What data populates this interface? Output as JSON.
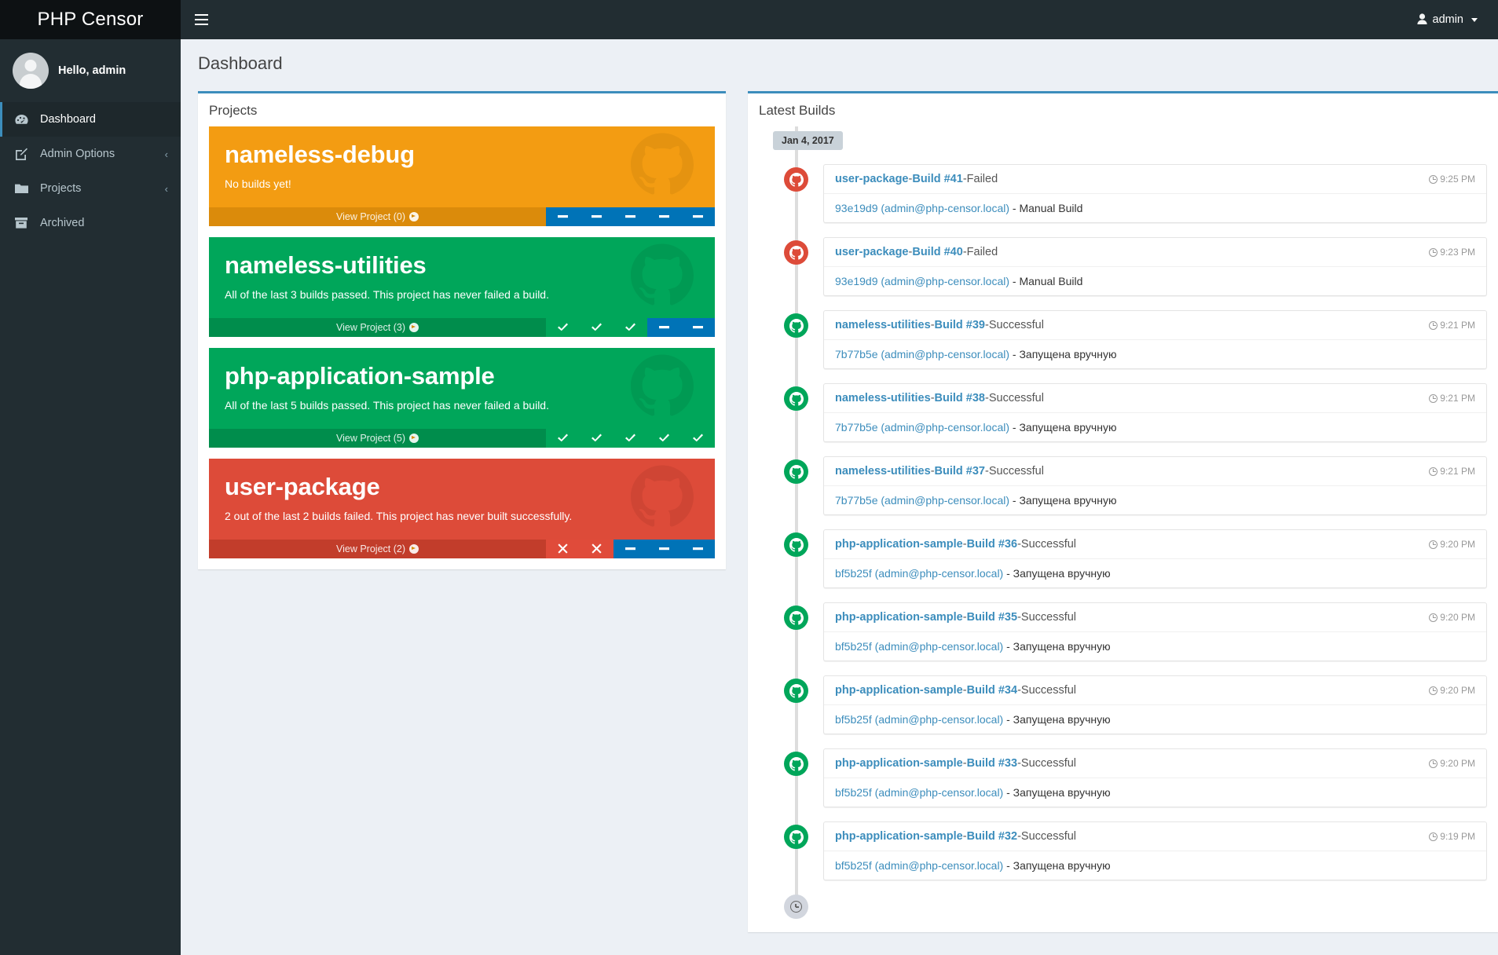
{
  "topbar": {
    "brand": "PHP Censor",
    "menu_toggle_icon": "hamburger-icon",
    "user_label": "admin",
    "user_icon": "user-icon"
  },
  "sidebar": {
    "greeting": "Hello, admin",
    "items": [
      {
        "label": "Dashboard",
        "icon": "dashboard-icon",
        "active": true,
        "arrow": ""
      },
      {
        "label": "Admin Options",
        "icon": "edit-icon",
        "active": false,
        "arrow": "‹"
      },
      {
        "label": "Projects",
        "icon": "folder-icon",
        "active": false,
        "arrow": "‹"
      },
      {
        "label": "Archived",
        "icon": "archive-icon",
        "active": false,
        "arrow": ""
      }
    ]
  },
  "page": {
    "title": "Dashboard"
  },
  "projects_box": {
    "header": "Projects",
    "cards": [
      {
        "name": "nameless-debug",
        "description": "No builds yet!",
        "link_label": "View Project (0)",
        "color": "c-orange",
        "stats": [
          "none",
          "none",
          "none",
          "none",
          "none"
        ]
      },
      {
        "name": "nameless-utilities",
        "description": "All of the last 3 builds passed. This project has never failed a build.",
        "link_label": "View Project (3)",
        "color": "c-green",
        "stats": [
          "ok",
          "ok",
          "ok",
          "none",
          "none"
        ]
      },
      {
        "name": "php-application-sample",
        "description": "All of the last 5 builds passed. This project has never failed a build.",
        "link_label": "View Project (5)",
        "color": "c-green",
        "stats": [
          "ok",
          "ok",
          "ok",
          "ok",
          "ok"
        ]
      },
      {
        "name": "user-package",
        "description": "2 out of the last 2 builds failed. This project has never built successfully.",
        "link_label": "View Project (2)",
        "color": "c-red",
        "stats": [
          "fail",
          "fail",
          "none",
          "none",
          "none"
        ]
      }
    ]
  },
  "builds_box": {
    "header": "Latest Builds",
    "date_badge": "Jan 4, 2017",
    "items": [
      {
        "project": "user-package",
        "build": "Build #41",
        "sep": " - ",
        "status": "Failed",
        "time": "9:25 PM",
        "commit": "93e19d9 (admin@php-censor.local)",
        "commit_sep": " - ",
        "source": "Manual Build",
        "icon_color": "ic-red"
      },
      {
        "project": "user-package",
        "build": "Build #40",
        "sep": " - ",
        "status": "Failed",
        "time": "9:23 PM",
        "commit": "93e19d9 (admin@php-censor.local)",
        "commit_sep": " - ",
        "source": "Manual Build",
        "icon_color": "ic-red"
      },
      {
        "project": "nameless-utilities",
        "build": "Build #39",
        "sep": " - ",
        "status": "Successful",
        "time": "9:21 PM",
        "commit": "7b77b5e (admin@php-censor.local)",
        "commit_sep": " - ",
        "source": "Запущена вручную",
        "icon_color": "ic-green"
      },
      {
        "project": "nameless-utilities",
        "build": "Build #38",
        "sep": " - ",
        "status": "Successful",
        "time": "9:21 PM",
        "commit": "7b77b5e (admin@php-censor.local)",
        "commit_sep": " - ",
        "source": "Запущена вручную",
        "icon_color": "ic-green"
      },
      {
        "project": "nameless-utilities",
        "build": "Build #37",
        "sep": " - ",
        "status": "Successful",
        "time": "9:21 PM",
        "commit": "7b77b5e (admin@php-censor.local)",
        "commit_sep": " - ",
        "source": "Запущена вручную",
        "icon_color": "ic-green"
      },
      {
        "project": "php-application-sample",
        "build": "Build #36",
        "sep": " - ",
        "status": "Successful",
        "time": "9:20 PM",
        "commit": "bf5b25f (admin@php-censor.local)",
        "commit_sep": " - ",
        "source": "Запущена вручную",
        "icon_color": "ic-green"
      },
      {
        "project": "php-application-sample",
        "build": "Build #35",
        "sep": " - ",
        "status": "Successful",
        "time": "9:20 PM",
        "commit": "bf5b25f (admin@php-censor.local)",
        "commit_sep": " - ",
        "source": "Запущена вручную",
        "icon_color": "ic-green"
      },
      {
        "project": "php-application-sample",
        "build": "Build #34",
        "sep": " - ",
        "status": "Successful",
        "time": "9:20 PM",
        "commit": "bf5b25f (admin@php-censor.local)",
        "commit_sep": " - ",
        "source": "Запущена вручную",
        "icon_color": "ic-green"
      },
      {
        "project": "php-application-sample",
        "build": "Build #33",
        "sep": " - ",
        "status": "Successful",
        "time": "9:20 PM",
        "commit": "bf5b25f (admin@php-censor.local)",
        "commit_sep": " - ",
        "source": "Запущена вручную",
        "icon_color": "ic-green"
      },
      {
        "project": "php-application-sample",
        "build": "Build #32",
        "sep": " - ",
        "status": "Successful",
        "time": "9:19 PM",
        "commit": "bf5b25f (admin@php-censor.local)",
        "commit_sep": " - ",
        "source": "Запущена вручную",
        "icon_color": "ic-green"
      }
    ],
    "end_icon": "clock-icon"
  },
  "colors": {
    "accent": "#3c8dbc",
    "sidebar": "#222d32",
    "success": "#00a65a",
    "danger": "#dd4b39",
    "warning": "#f39c12",
    "info": "#0073b7",
    "page_bg": "#ecf0f5"
  }
}
